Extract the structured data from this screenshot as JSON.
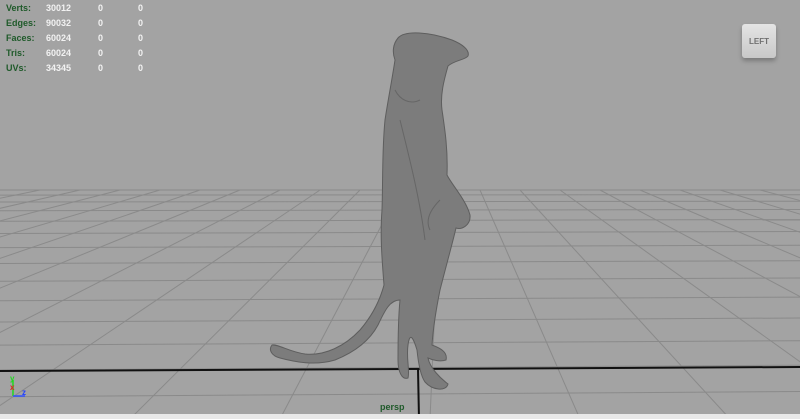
{
  "stats": [
    {
      "label": "Verts:",
      "values": [
        "30012",
        "0",
        "0"
      ]
    },
    {
      "label": "Edges:",
      "values": [
        "90032",
        "0",
        "0"
      ]
    },
    {
      "label": "Faces:",
      "values": [
        "60024",
        "0",
        "0"
      ]
    },
    {
      "label": "Tris:",
      "values": [
        "60024",
        "0",
        "0"
      ]
    },
    {
      "label": "UVs:",
      "values": [
        "34345",
        "0",
        "0"
      ]
    }
  ],
  "view_cube": {
    "label": "LEFT"
  },
  "camera": "persp",
  "axis": {
    "y": "y",
    "x": "x",
    "z": "z"
  },
  "colors": {
    "background": "#a3a3a3",
    "hud_label": "#1f5a2a",
    "hud_value": "#f2f2f2",
    "mesh": "#7c7c7c"
  }
}
